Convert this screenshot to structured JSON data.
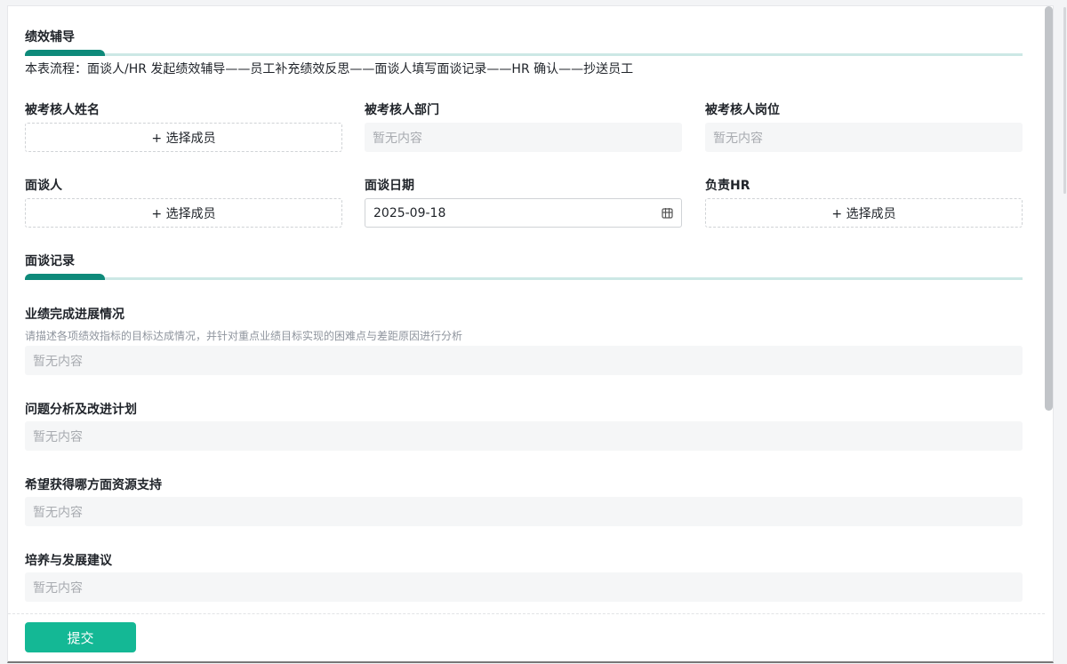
{
  "sections": [
    {
      "title": "绩效辅导"
    },
    {
      "title": "面谈记录"
    }
  ],
  "flow_text": "本表流程：面谈人/HR 发起绩效辅导——员工补充绩效反思——面谈人填写面谈记录——HR 确认——抄送员工",
  "fields": {
    "name": {
      "label": "被考核人姓名",
      "value": "+ 选择成员"
    },
    "dept": {
      "label": "被考核人部门",
      "value": "暂无内容"
    },
    "post": {
      "label": "被考核人岗位",
      "value": "暂无内容"
    },
    "interviewer": {
      "label": "面谈人",
      "value": "+ 选择成员"
    },
    "date": {
      "label": "面谈日期",
      "value": "2025-09-18",
      "icon": "calendar-icon"
    },
    "hr": {
      "label": "负责HR",
      "value": "+ 选择成员"
    }
  },
  "records": [
    {
      "label": "业绩完成进展情况",
      "hint": "请描述各项绩效指标的目标达成情况，并针对重点业绩目标实现的困难点与差距原因进行分析",
      "value": "暂无内容"
    },
    {
      "label": "问题分析及改进计划",
      "value": "暂无内容"
    },
    {
      "label": "希望获得哪方面资源支持",
      "value": "暂无内容"
    },
    {
      "label": "培养与发展建议",
      "value": "暂无内容"
    }
  ],
  "submit_label": "提交",
  "colors": {
    "accent": "#14b895",
    "bar": "#0e8a7a",
    "line": "#cce8e5"
  }
}
